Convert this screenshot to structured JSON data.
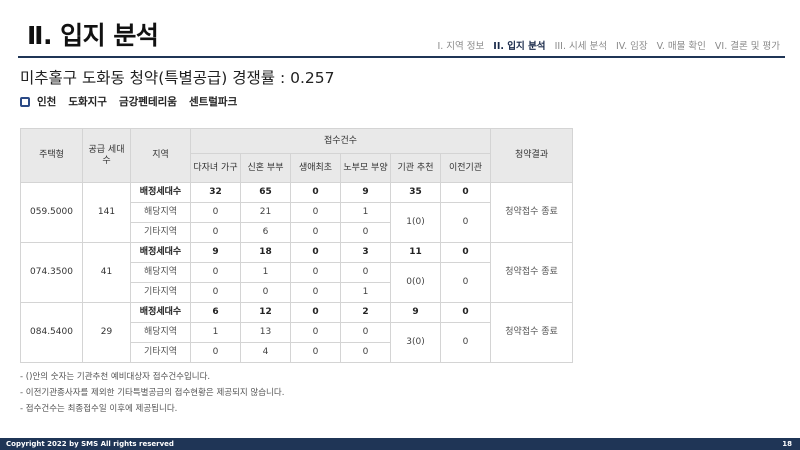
{
  "header": {
    "title": "Ⅱ. 입지 분석",
    "nav": [
      {
        "label": "I. 지역 정보",
        "active": false
      },
      {
        "label": "II. 입지 분석",
        "active": true
      },
      {
        "label": "III. 시세 분석",
        "active": false
      },
      {
        "label": "IV. 임장",
        "active": false
      },
      {
        "label": "V. 매물 확인",
        "active": false
      },
      {
        "label": "VI. 결론 및 평가",
        "active": false
      }
    ]
  },
  "subtitle": "미추홀구 도화동 청약(특별공급) 경쟁률 : 0.257",
  "location": {
    "parts": [
      "인천",
      "도화지구",
      "금강펜테리움",
      "센트럴파크"
    ],
    "bullet_color": "#2b4a86"
  },
  "table": {
    "headers": {
      "housing_type": "주택형",
      "supply_units": "공급 세대수",
      "region": "지역",
      "received": "접수건수",
      "result": "청약결과",
      "sub": [
        "다자녀 가구",
        "신혼 부부",
        "생애최초",
        "노부모 부양",
        "기관 추천",
        "이전기관"
      ]
    },
    "groups": [
      {
        "type": "059.5000",
        "supply": "141",
        "rows": [
          {
            "region": "배정세대수",
            "values": [
              "32",
              "65",
              "0",
              "9"
            ],
            "agency": "35",
            "relocated": "0"
          },
          {
            "region": "해당지역",
            "values": [
              "0",
              "21",
              "0",
              "1"
            ]
          },
          {
            "region": "기타지역",
            "values": [
              "0",
              "6",
              "0",
              "0"
            ]
          }
        ],
        "agency_received": "1(0)",
        "relocated_received": "0",
        "result": "청약접수 종료"
      },
      {
        "type": "074.3500",
        "supply": "41",
        "rows": [
          {
            "region": "배정세대수",
            "values": [
              "9",
              "18",
              "0",
              "3"
            ],
            "agency": "11",
            "relocated": "0"
          },
          {
            "region": "해당지역",
            "values": [
              "0",
              "1",
              "0",
              "0"
            ]
          },
          {
            "region": "기타지역",
            "values": [
              "0",
              "0",
              "0",
              "1"
            ]
          }
        ],
        "agency_received": "0(0)",
        "relocated_received": "0",
        "result": "청약접수 종료"
      },
      {
        "type": "084.5400",
        "supply": "29",
        "rows": [
          {
            "region": "배정세대수",
            "values": [
              "6",
              "12",
              "0",
              "2"
            ],
            "agency": "9",
            "relocated": "0"
          },
          {
            "region": "해당지역",
            "values": [
              "1",
              "13",
              "0",
              "0"
            ]
          },
          {
            "region": "기타지역",
            "values": [
              "0",
              "4",
              "0",
              "0"
            ]
          }
        ],
        "agency_received": "3(0)",
        "relocated_received": "0",
        "result": "청약접수 종료"
      }
    ]
  },
  "notes": [
    "- ()안의 숫자는 기관추천 예비대상자 접수건수입니다.",
    "- 이전기관종사자를 제외한 기타특별공급의 접수현황은 제공되지 않습니다.",
    "- 접수건수는 최종접수일 이후에 제공됩니다."
  ],
  "footer": {
    "copyright": "Copyright 2022 by SMS All rights reserved",
    "page_number": "18"
  }
}
